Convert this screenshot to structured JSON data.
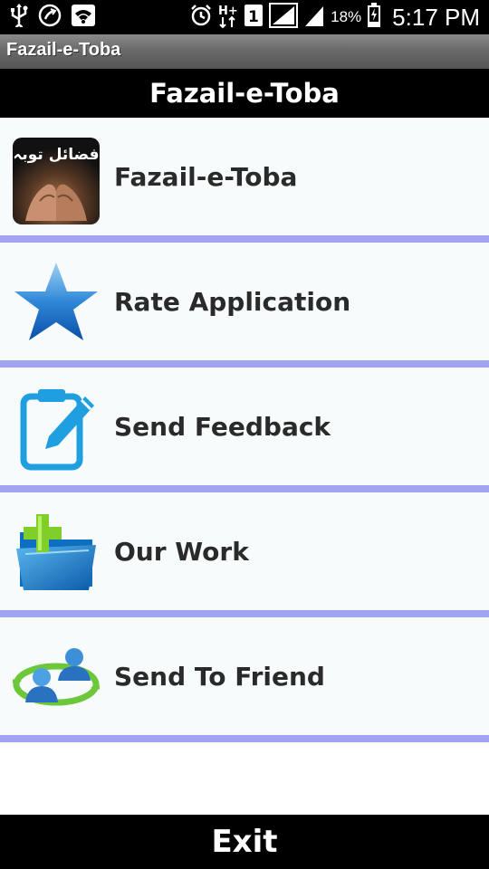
{
  "status_bar": {
    "battery_percent": "18%",
    "time": "5:17 PM",
    "left_icons": [
      "usb-icon",
      "call-forward-icon",
      "wifi-icon"
    ],
    "right_icons": [
      "alarm-icon",
      "hplus-data-icon",
      "sim1-icon",
      "signal-icon",
      "signal-icon",
      "battery-icon"
    ]
  },
  "window_title": "Fazail-e-Toba",
  "header": {
    "title": "Fazail-e-Toba"
  },
  "app_icon_text": "فضائل توبہ",
  "menu": {
    "items": [
      {
        "label": "Fazail-e-Toba",
        "icon": "praying-hands-icon"
      },
      {
        "label": "Rate Application",
        "icon": "star-icon"
      },
      {
        "label": "Send Feedback",
        "icon": "edit-note-icon"
      },
      {
        "label": "Our Work",
        "icon": "folder-add-icon"
      },
      {
        "label": "Send To Friend",
        "icon": "share-users-icon"
      }
    ]
  },
  "footer": {
    "label": "Exit"
  },
  "colors": {
    "divider": "#a1a4f0",
    "item_background": "#f8fbfc",
    "bar_background": "#000000"
  }
}
